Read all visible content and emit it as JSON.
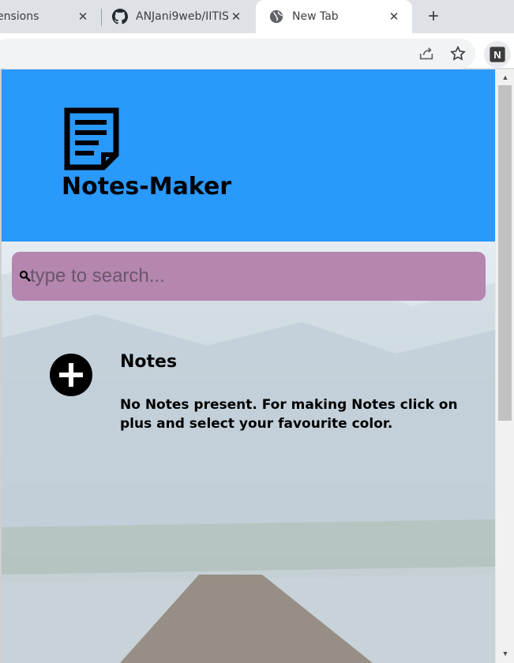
{
  "browser": {
    "tabs": [
      {
        "title": "ensions",
        "icon": "extensions-favicon"
      },
      {
        "title": "ANJani9web/IITIS",
        "icon": "github-icon"
      },
      {
        "title": "New Tab",
        "icon": "globe-icon",
        "active": true
      }
    ],
    "tab_close_glyph": "✕",
    "new_tab_glyph": "+",
    "profile_initial": "N"
  },
  "app": {
    "title": "Notes-Maker",
    "header_color": "#2999fb",
    "search": {
      "placeholder": "type to search...",
      "value": "",
      "color": "#b486b0"
    },
    "notes_heading": "Notes",
    "empty_message": "No Notes present. For making Notes click on plus and select your favourite color."
  }
}
